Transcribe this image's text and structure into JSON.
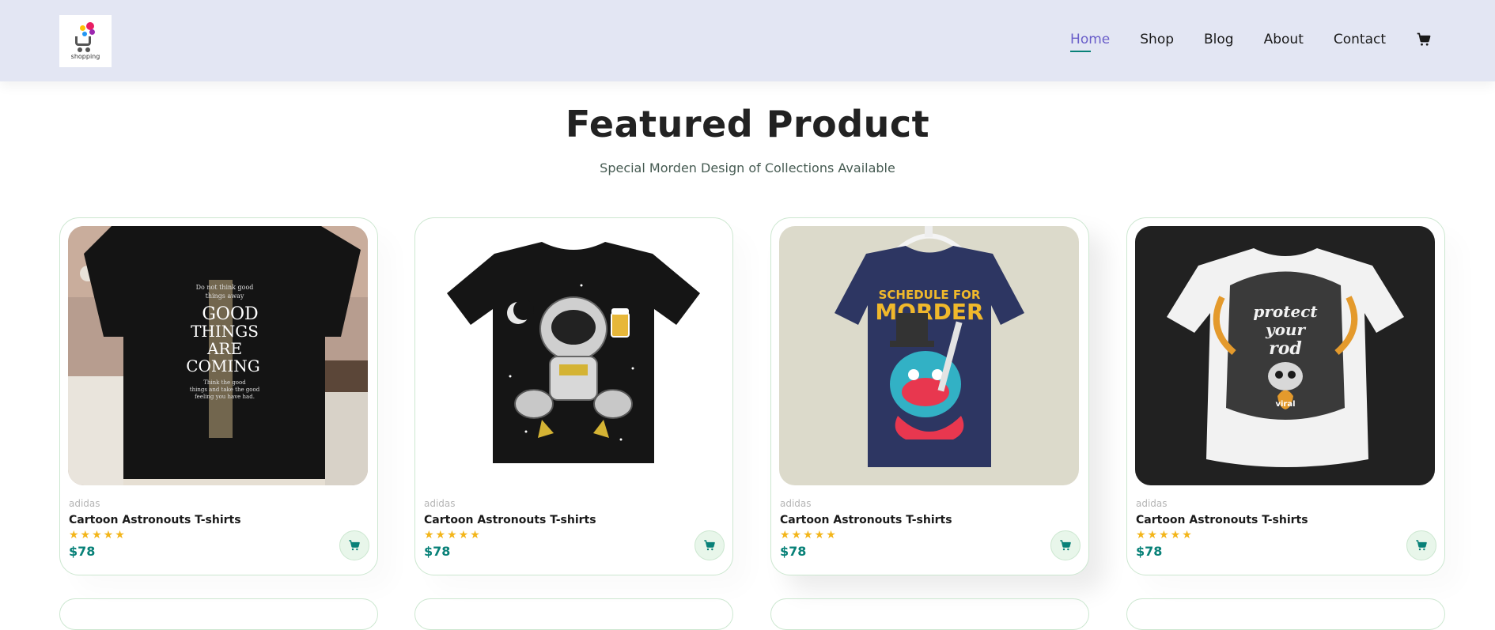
{
  "header": {
    "logo_text": "shopping",
    "nav": [
      {
        "label": "Home",
        "active": true
      },
      {
        "label": "Shop",
        "active": false
      },
      {
        "label": "Blog",
        "active": false
      },
      {
        "label": "About",
        "active": false
      },
      {
        "label": "Contact",
        "active": false
      }
    ],
    "cart_icon": "cart-icon"
  },
  "section": {
    "title": "Featured Product",
    "subtitle": "Special Morden Design of Collections Available"
  },
  "products": [
    {
      "brand": "adidas",
      "name": "Cartoon Astronouts T-shirts",
      "rating": 5,
      "stars": "★★★★★",
      "price": "$78",
      "image": "black tee with 'GOOD THINGS ARE COMING' print on model"
    },
    {
      "brand": "adidas",
      "name": "Cartoon Astronouts T-shirts",
      "rating": 5,
      "stars": "★★★★★",
      "price": "$78",
      "image": "black tee with astronaut holding beer"
    },
    {
      "brand": "adidas",
      "name": "Cartoon Astronouts T-shirts",
      "rating": 5,
      "stars": "★★★★★",
      "price": "$78",
      "image": "navy tee with 'SCHEDULE FOR MORDER' monster print"
    },
    {
      "brand": "adidas",
      "name": "Cartoon Astronouts T-shirts",
      "rating": 5,
      "stars": "★★★★★",
      "price": "$78",
      "image": "white tee with 'protect your rod' skull print"
    }
  ],
  "tee1_print": [
    "Do not think good",
    "things away",
    "GOOD",
    "THINGS",
    "ARE",
    "COMING",
    "Think the good",
    "things and take the good",
    "feeling you have had."
  ],
  "tee3_print": [
    "SCHEDULE FOR",
    "MORDER"
  ],
  "tee4_print": [
    "protect",
    "your",
    "rod",
    "viral"
  ],
  "colors": {
    "header_bg": "#e3e6f3",
    "active_nav": "#6a5ec9",
    "accent": "#088178",
    "star": "#f3b519",
    "card_border": "#cce7d0"
  }
}
